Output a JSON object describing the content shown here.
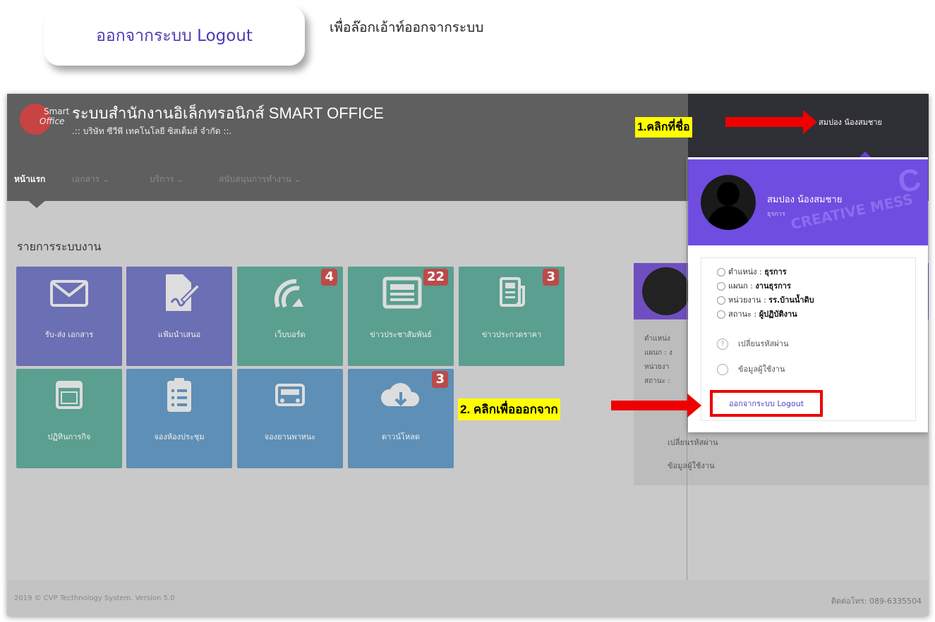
{
  "top": {
    "button_label": "ออกจากระบบ Logout",
    "caption": "เพื่อล๊อกเอ้าท์ออกจากระบบ"
  },
  "header": {
    "logo_line1": "Smart",
    "logo_line2": "Office",
    "title": "ระบบสำนักงานอิเล็กทรอนิกส์ SMART OFFICE",
    "subtitle": ".:: บริษัท ซีวีพี เทคโนโลยี ซิสเต็มส์ จำกัด ::.",
    "user_name": "สมปอง น้องสมชาย"
  },
  "nav": [
    "หน้าแรก",
    "เอกสาร ⌄",
    "บริการ ⌄",
    "สนับสนุนการทำงาน ⌄"
  ],
  "section_title": "รายการระบบงาน",
  "tiles": [
    {
      "label": "รับ-ส่ง เอกสาร",
      "badge": "",
      "icon": "envelope-icon"
    },
    {
      "label": "แฟ้มนำเสนอ",
      "badge": "",
      "icon": "sign-document-icon"
    },
    {
      "label": "เว็บบอร์ด",
      "badge": "4",
      "icon": "webboard-icon"
    },
    {
      "label": "ข่าวประชาสัมพันธ์",
      "badge": "22",
      "icon": "newspaper-icon"
    },
    {
      "label": "ข่าวประกวดราคา",
      "badge": "3",
      "icon": "news-icon"
    },
    {
      "label": "ปฏิทินการกิจ",
      "badge": "",
      "icon": "calendar-icon"
    },
    {
      "label": "จองห้องประชุม",
      "badge": "",
      "icon": "clipboard-icon"
    },
    {
      "label": "จองยานพาหนะ",
      "badge": "",
      "icon": "car-icon"
    },
    {
      "label": "ดาวน์โหลด",
      "badge": "3",
      "icon": "download-icon"
    }
  ],
  "dropdown": {
    "name": "สมปอง น้องสมชาย",
    "role": "ธุรการ",
    "header_deco": "C",
    "header_deco2": "CREATIVE MESS",
    "info": [
      {
        "label": "ตำแหน่ง :",
        "value": "ธุรการ"
      },
      {
        "label": "แผนก :",
        "value": "งานธุรการ"
      },
      {
        "label": "หน่วยงาน :",
        "value": "รร.บ้านน้ำดิบ"
      },
      {
        "label": "สถานะ :",
        "value": "ผู้ปฏิบัติงาน"
      }
    ],
    "menu": [
      "เปลี่ยนรหัสผ่าน",
      "ข้อมูลผู้ใช้งาน"
    ],
    "logout_label": "ออกจากระบบ Logout"
  },
  "background_card": {
    "info": [
      "ตำแหน่ง",
      "แผนก : ง",
      "หน่วยงา",
      "สถานะ :"
    ],
    "menu": [
      "เปลี่ยนรหัสผ่าน",
      "ข้อมูลผู้ใช้งาน"
    ]
  },
  "footer": {
    "left": "2019 © CVP Tecthnology System. Version 5.0",
    "right": "ติดต่อโทร: 089-6335504"
  },
  "annotations": {
    "step1": "1.คลิกที่ชื่อ",
    "step2": "2. คลิกเพื่อออกจาก"
  },
  "colors": {
    "purple": "#6b6fb3",
    "teal": "#5a9f8f",
    "blue": "#5e8fb6",
    "accent": "#6e4de0",
    "arrow": "#e00000",
    "note_bg": "#ffff00"
  }
}
